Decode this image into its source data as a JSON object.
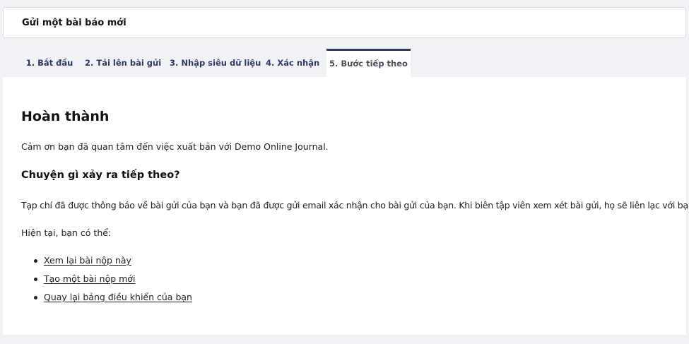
{
  "header": {
    "title": "Gửi một bài báo mới"
  },
  "tabs": [
    {
      "label": "1. Bắt đầu",
      "active": false
    },
    {
      "label": "2. Tải lên bài gửi",
      "active": false
    },
    {
      "label": "3. Nhập siêu dữ liệu",
      "active": false
    },
    {
      "label": "4. Xác nhận",
      "active": false
    },
    {
      "label": "5. Bước tiếp theo",
      "active": true
    }
  ],
  "content": {
    "heading": "Hoàn thành",
    "thanks": "Cảm ơn bạn đã quan tâm đến việc xuất bản với Demo Online Journal.",
    "subheading": "Chuyện gì xảy ra tiếp theo?",
    "notified": "Tạp chí đã được thông báo về bài gửi của bạn và bạn đã được gửi email xác nhận cho bài gửi của bạn. Khi biên tập viên xem xét bài gửi, họ sẽ liên lạc với bạn.",
    "now": "Hiện tại, bạn có thể:",
    "actions": [
      "Xem lại bài nộp này",
      "Tạo một bài nộp mới",
      "Quay lại bảng điều khiển của bạn"
    ]
  },
  "colors": {
    "page_background": "#f0f2f6",
    "accent": "#2f3b66",
    "card": "#ffffff"
  }
}
